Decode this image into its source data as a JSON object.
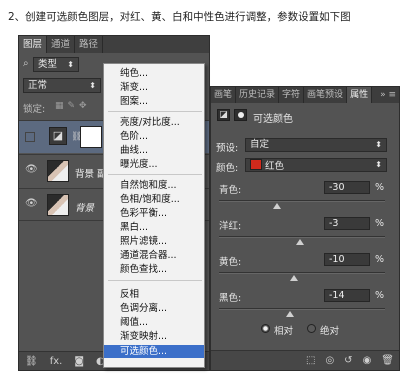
{
  "caption": "2、创建可选颜色图层，对红、黄、白和中性色进行调整，参数设置如下图",
  "layers_panel": {
    "tabs": [
      "图层",
      "通道",
      "路径"
    ],
    "active_tab": 0,
    "filter_label": "类型",
    "blend_mode": "正常",
    "lock_label": "锁定:",
    "layers": [
      {
        "name": "",
        "type": "adjustment"
      },
      {
        "name": "背景 副本",
        "type": "image"
      },
      {
        "name": "背景",
        "type": "image"
      }
    ],
    "footer_icons": [
      "link-icon",
      "fx-icon",
      "mask-icon",
      "adjustment-icon",
      "folder-icon",
      "new-layer-icon",
      "trash-icon"
    ]
  },
  "menu": {
    "groups": [
      [
        "纯色...",
        "渐变...",
        "图案..."
      ],
      [
        "亮度/对比度...",
        "色阶...",
        "曲线...",
        "曝光度..."
      ],
      [
        "自然饱和度...",
        "色相/饱和度...",
        "色彩平衡...",
        "黑白...",
        "照片滤镜...",
        "通道混合器...",
        "颜色查找..."
      ],
      [
        "反相",
        "色调分离...",
        "阈值...",
        "渐变映射...",
        "可选颜色..."
      ]
    ],
    "selected": "可选颜色..."
  },
  "properties": {
    "tabs": [
      "画笔",
      "历史记录",
      "字符",
      "画笔预设",
      "属性"
    ],
    "active_tab": 4,
    "title": "可选颜色",
    "preset_label": "预设:",
    "preset_value": "自定",
    "colors_label": "颜色:",
    "colors_value": "红色",
    "colors_swatch": "#d12a1c",
    "sliders": [
      {
        "label": "青色:",
        "value": "-30",
        "unit": "%",
        "level": -30
      },
      {
        "label": "洋红:",
        "value": "-3",
        "unit": "%",
        "level": -3
      },
      {
        "label": "黄色:",
        "value": "-10",
        "unit": "%",
        "level": -10
      },
      {
        "label": "黑色:",
        "value": "-14",
        "unit": "%",
        "level": -14
      }
    ],
    "method_options": [
      "相对",
      "绝对"
    ],
    "method_selected": 0
  }
}
